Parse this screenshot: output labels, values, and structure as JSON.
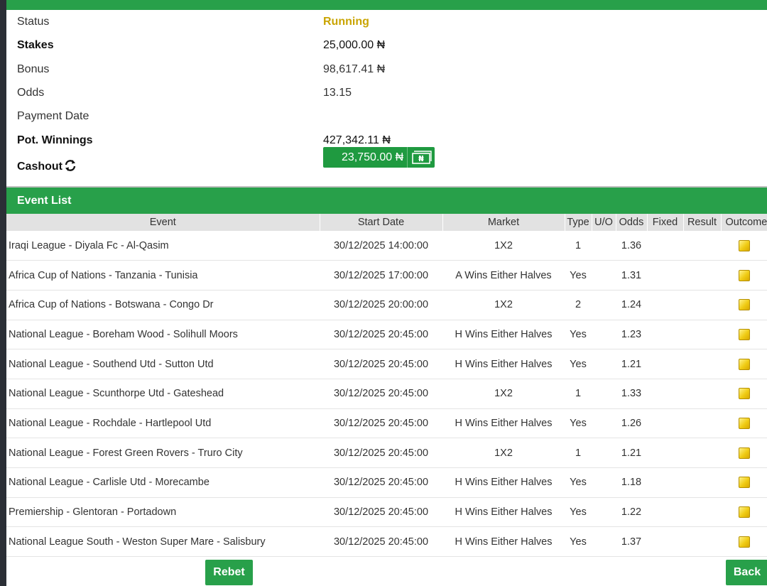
{
  "summary": {
    "status_label": "Status",
    "status_value": "Running",
    "stakes_label": "Stakes",
    "stakes_value": "25,000.00 ₦",
    "bonus_label": "Bonus",
    "bonus_value": "98,617.41 ₦",
    "odds_label": "Odds",
    "odds_value": "13.15",
    "payment_date_label": "Payment Date",
    "payment_date_value": "",
    "pot_winnings_label": "Pot. Winnings",
    "pot_winnings_value": "427,342.11 ₦",
    "cashout_label": "Cashout",
    "cashout_value": "23,750.00 ₦",
    "cashout_icon": "refresh-icon",
    "cashout_button_icon": "money-icon"
  },
  "event_list": {
    "title": "Event List",
    "columns": [
      "Event",
      "Start Date",
      "Market",
      "Type",
      "U/O",
      "Odds",
      "Fixed",
      "Result",
      "Outcome"
    ],
    "rows": [
      {
        "event": "Iraqi League - Diyala Fc - Al-Qasim",
        "start": "30/12/2025 14:00:00",
        "market": "1X2",
        "type": "1",
        "uo": "",
        "odds": "1.36",
        "fixed": "",
        "result": ""
      },
      {
        "event": "Africa Cup of Nations - Tanzania - Tunisia",
        "start": "30/12/2025 17:00:00",
        "market": "A Wins Either Halves",
        "type": "Yes",
        "uo": "",
        "odds": "1.31",
        "fixed": "",
        "result": ""
      },
      {
        "event": "Africa Cup of Nations - Botswana - Congo Dr",
        "start": "30/12/2025 20:00:00",
        "market": "1X2",
        "type": "2",
        "uo": "",
        "odds": "1.24",
        "fixed": "",
        "result": ""
      },
      {
        "event": "National League - Boreham Wood - Solihull Moors",
        "start": "30/12/2025 20:45:00",
        "market": "H Wins Either Halves",
        "type": "Yes",
        "uo": "",
        "odds": "1.23",
        "fixed": "",
        "result": ""
      },
      {
        "event": "National League - Southend Utd - Sutton Utd",
        "start": "30/12/2025 20:45:00",
        "market": "H Wins Either Halves",
        "type": "Yes",
        "uo": "",
        "odds": "1.21",
        "fixed": "",
        "result": ""
      },
      {
        "event": "National League - Scunthorpe Utd - Gateshead",
        "start": "30/12/2025 20:45:00",
        "market": "1X2",
        "type": "1",
        "uo": "",
        "odds": "1.33",
        "fixed": "",
        "result": ""
      },
      {
        "event": "National League - Rochdale - Hartlepool Utd",
        "start": "30/12/2025 20:45:00",
        "market": "H Wins Either Halves",
        "type": "Yes",
        "uo": "",
        "odds": "1.26",
        "fixed": "",
        "result": ""
      },
      {
        "event": "National League - Forest Green Rovers - Truro City",
        "start": "30/12/2025 20:45:00",
        "market": "1X2",
        "type": "1",
        "uo": "",
        "odds": "1.21",
        "fixed": "",
        "result": ""
      },
      {
        "event": "National League - Carlisle Utd - Morecambe",
        "start": "30/12/2025 20:45:00",
        "market": "H Wins Either Halves",
        "type": "Yes",
        "uo": "",
        "odds": "1.18",
        "fixed": "",
        "result": ""
      },
      {
        "event": "Premiership - Glentoran - Portadown",
        "start": "30/12/2025 20:45:00",
        "market": "H Wins Either Halves",
        "type": "Yes",
        "uo": "",
        "odds": "1.22",
        "fixed": "",
        "result": ""
      },
      {
        "event": "National League South - Weston Super Mare - Salisbury",
        "start": "30/12/2025 20:45:00",
        "market": "H Wins Either Halves",
        "type": "Yes",
        "uo": "",
        "odds": "1.37",
        "fixed": "",
        "result": ""
      }
    ],
    "outcome_icon": "pending-outcome-icon"
  },
  "actions": {
    "rebet_label": "Rebet",
    "back_label": "Back"
  },
  "colors": {
    "brand_green": "#28a04a",
    "status_running": "#c9a400",
    "header_gray": "#e2e2e2"
  }
}
